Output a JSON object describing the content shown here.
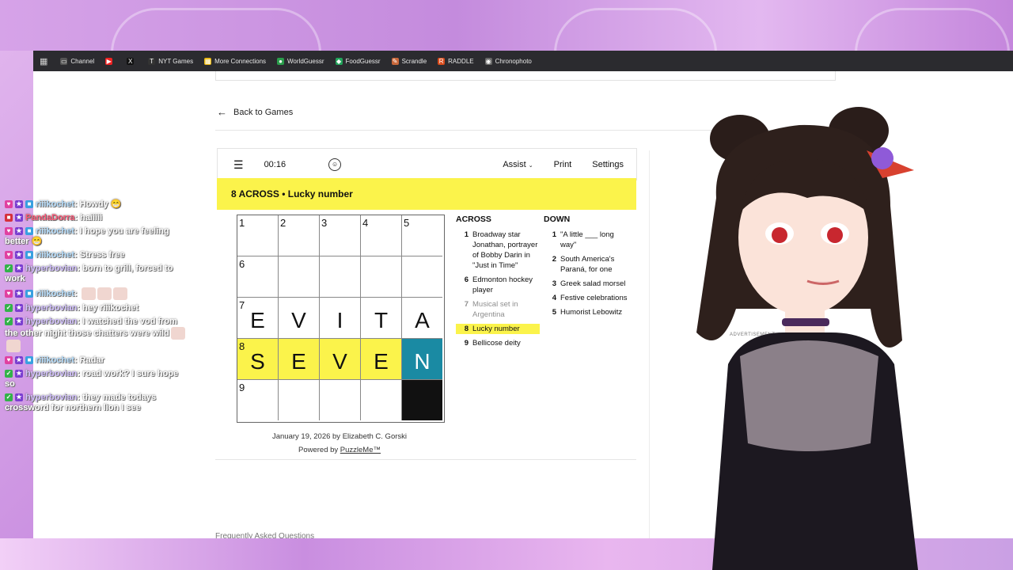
{
  "bookmarks": [
    {
      "icon": "tv-icon",
      "label": "Channel"
    },
    {
      "icon": "youtube-icon",
      "label": ""
    },
    {
      "icon": "x-icon",
      "label": ""
    },
    {
      "icon": "nyt-icon",
      "label": "NYT Games"
    },
    {
      "icon": "grid-icon",
      "label": "More Connections"
    },
    {
      "icon": "globe-icon",
      "label": "WorldGuessr"
    },
    {
      "icon": "food-icon",
      "label": "FoodGuessr"
    },
    {
      "icon": "scrandle-icon",
      "label": "Scrandle"
    },
    {
      "icon": "raddle-icon",
      "label": "RADDLE"
    },
    {
      "icon": "camera-icon",
      "label": "Chronophoto"
    }
  ],
  "nav": {
    "back_label": "Back to Games"
  },
  "toolbar": {
    "timer": "00:16",
    "assist": "Assist",
    "print": "Print",
    "settings": "Settings"
  },
  "clue_bar": {
    "label": "8 ACROSS  •  Lucky number"
  },
  "grid": {
    "rows": [
      [
        {
          "n": "1",
          "l": ""
        },
        {
          "n": "2",
          "l": ""
        },
        {
          "n": "3",
          "l": ""
        },
        {
          "n": "4",
          "l": ""
        },
        {
          "n": "5",
          "l": ""
        }
      ],
      [
        {
          "n": "6",
          "l": ""
        },
        {
          "n": "",
          "l": ""
        },
        {
          "n": "",
          "l": ""
        },
        {
          "n": "",
          "l": ""
        },
        {
          "n": "",
          "l": ""
        }
      ],
      [
        {
          "n": "7",
          "l": ""
        },
        {
          "n": "",
          "l": "V"
        },
        {
          "n": "",
          "l": "I"
        },
        {
          "n": "",
          "l": "T"
        },
        {
          "n": "",
          "l": "A"
        }
      ],
      [
        {
          "n": "8",
          "l": "S"
        },
        {
          "n": "",
          "l": "E"
        },
        {
          "n": "",
          "l": "V"
        },
        {
          "n": "",
          "l": "E"
        },
        {
          "n": "",
          "l": "N"
        }
      ],
      [
        {
          "n": "9",
          "l": ""
        },
        {
          "n": "",
          "l": ""
        },
        {
          "n": "",
          "l": ""
        },
        {
          "n": "",
          "l": ""
        },
        {
          "n": "",
          "l": ""
        }
      ]
    ],
    "row7_first_letter": "E",
    "colors": {
      "highlight": "#fbf34b",
      "active": "#1a8aa3",
      "block": "#111111"
    }
  },
  "clues": {
    "across_title": "ACROSS",
    "down_title": "DOWN",
    "across": [
      {
        "n": "1",
        "t": "Broadway star Jonathan, portrayer of Bobby Darin in \"Just in Time\""
      },
      {
        "n": "6",
        "t": "Edmonton hockey player"
      },
      {
        "n": "7",
        "t": "Musical set in Argentina"
      },
      {
        "n": "8",
        "t": "Lucky number"
      },
      {
        "n": "9",
        "t": "Bellicose deity"
      }
    ],
    "down": [
      {
        "n": "1",
        "t": "\"A little ___ long way\""
      },
      {
        "n": "2",
        "t": "South America's Paraná, for one"
      },
      {
        "n": "3",
        "t": "Greek salad morsel"
      },
      {
        "n": "4",
        "t": "Festive celebrations"
      },
      {
        "n": "5",
        "t": "Humorist Lebowitz"
      }
    ]
  },
  "byline": {
    "date_author": "January 19, 2026 by Elizabeth C. Gorski",
    "powered_prefix": "Powered by ",
    "powered_link": "PuzzleMe™"
  },
  "faq": "Frequently Asked Questions",
  "advertisement": "ADVERTISEMENT",
  "chat": [
    {
      "user": "riiikochet",
      "cls": "user-r",
      "badges": [
        "pink",
        "purple",
        "blue"
      ],
      "text": "Howdy 😁"
    },
    {
      "user": "PandaDorra",
      "cls": "user-p",
      "badges": [
        "red",
        "purple"
      ],
      "text": "haiiiii"
    },
    {
      "user": "riiikochet",
      "cls": "user-r",
      "badges": [
        "pink",
        "purple",
        "blue"
      ],
      "text": "I hope you are feeling better 😁"
    },
    {
      "user": "riiikochet",
      "cls": "user-r",
      "badges": [
        "pink",
        "purple",
        "blue"
      ],
      "text": "Stress free"
    },
    {
      "user": "hyperbovian",
      "cls": "user-h",
      "badges": [
        "green",
        "purple"
      ],
      "text": "born to grill, forced to work"
    },
    {
      "user": "riiikochet",
      "cls": "user-r",
      "badges": [
        "pink",
        "purple",
        "blue"
      ],
      "text": "",
      "emotes": 3
    },
    {
      "user": "hyperbovian",
      "cls": "user-h",
      "badges": [
        "green",
        "purple"
      ],
      "text": "hey riiikochet"
    },
    {
      "user": "hyperbovian",
      "cls": "user-h",
      "badges": [
        "green",
        "purple"
      ],
      "text": "I watched the vod from the other night those chatters were wild",
      "emotes": 2
    },
    {
      "user": "riiikochet",
      "cls": "user-r",
      "badges": [
        "pink",
        "purple",
        "blue"
      ],
      "text": "Radar"
    },
    {
      "user": "hyperbovian",
      "cls": "user-h",
      "badges": [
        "green",
        "purple"
      ],
      "text": "road work? I sure hope so"
    },
    {
      "user": "hyperbovian",
      "cls": "user-h",
      "badges": [
        "green",
        "purple"
      ],
      "text": "they made todays crossword for northern lion I see"
    }
  ]
}
